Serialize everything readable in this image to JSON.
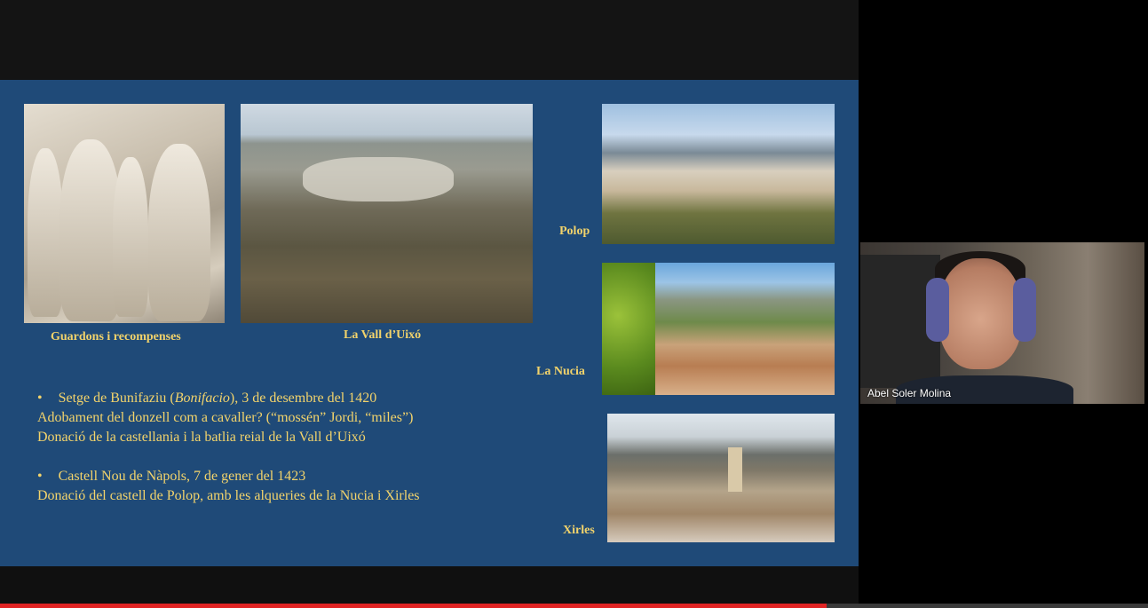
{
  "slide": {
    "photos": [
      {
        "name": "relief",
        "caption": "Guardons i recompenses"
      },
      {
        "name": "valley",
        "caption": "La Vall d’Uixó"
      },
      {
        "name": "polop",
        "caption": "Polop"
      },
      {
        "name": "nucia",
        "caption": "La Nucia"
      },
      {
        "name": "xirles",
        "caption": "Xirles"
      }
    ],
    "bullets": {
      "b1_prefix": "Setge de Bunifaziu (",
      "b1_italic": "Bonifacio",
      "b1_suffix": "), 3 de desembre del 1420",
      "b1_line2": "Adobament del donzell com a cavaller? (“mossén” Jordi, “miles”)",
      "b1_line3": "Donació de la castellania i la batlia reial de la Vall d’Uixó",
      "b2_line1": "Castell Nou de Nàpols, 7 de gener del 1423",
      "b2_line2": "Donació del castell de Polop, amb les alqueries de la Nucia i Xirles"
    },
    "bullet_symbol": "•"
  },
  "webcam": {
    "participant_name": "Abel Soler Molina"
  },
  "player": {
    "progress_fraction": 0.72
  }
}
